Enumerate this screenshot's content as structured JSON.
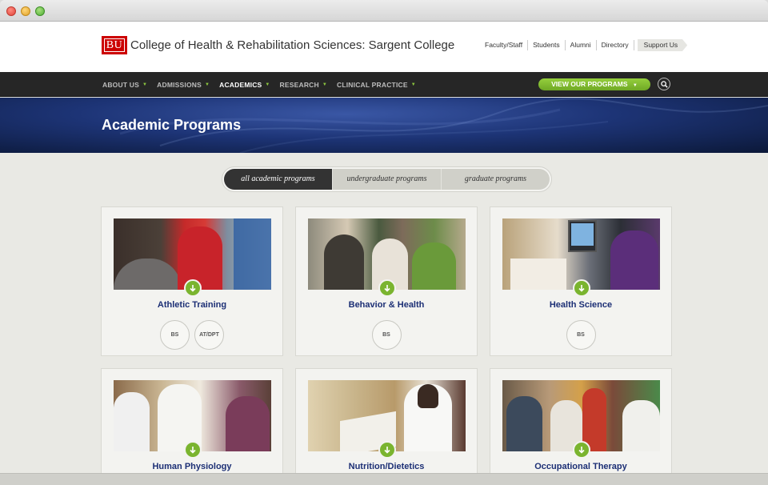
{
  "header": {
    "logo_text": "BU",
    "college_title": "College of Health & Rehabilitation Sciences: Sargent College",
    "utility_links": [
      "Faculty/Staff",
      "Students",
      "Alumni",
      "Directory"
    ],
    "support_label": "Support Us"
  },
  "nav": {
    "items": [
      {
        "label": "ABOUT US"
      },
      {
        "label": "ADMISSIONS"
      },
      {
        "label": "ACADEMICS"
      },
      {
        "label": "RESEARCH"
      },
      {
        "label": "CLINICAL PRACTICE"
      }
    ],
    "active_item": "ACADEMICS",
    "programs_button": "VIEW OUR PROGRAMS",
    "search_icon": "search-icon"
  },
  "hero": {
    "title": "Academic Programs"
  },
  "tabs": [
    "all academic programs",
    "undergraduate programs",
    "graduate programs"
  ],
  "cards": [
    {
      "title": "Athletic Training",
      "degrees": [
        "BS",
        "AT/DPT"
      ]
    },
    {
      "title": "Behavior & Health",
      "degrees": [
        "BS"
      ]
    },
    {
      "title": "Health Science",
      "degrees": [
        "BS"
      ]
    },
    {
      "title": "Human Physiology",
      "degrees": []
    },
    {
      "title": "Nutrition/Dietetics",
      "degrees": []
    },
    {
      "title": "Occupational Therapy",
      "degrees": []
    }
  ],
  "colors": {
    "accent_green": "#7ab42f",
    "brand_red": "#cc0000",
    "title_navy": "#1c2f75",
    "nav_bg": "#262626"
  }
}
